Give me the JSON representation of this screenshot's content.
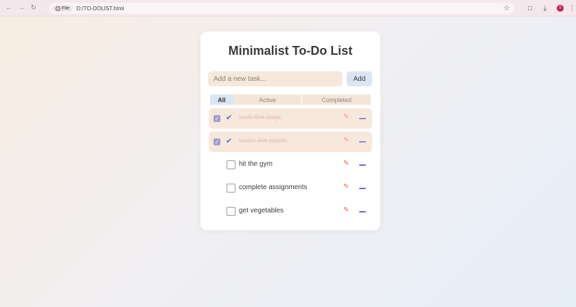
{
  "browser": {
    "back_icon": "arrow-left-icon",
    "forward_icon": "arrow-right-icon",
    "reload_icon": "reload-icon",
    "info_label": "File",
    "url": "D:/TO-DOLIST.html",
    "profile_initial": "S"
  },
  "app": {
    "title": "Minimalist To-Do List",
    "input_placeholder": "Add a new task...",
    "input_value": "",
    "add_label": "Add",
    "filters": {
      "all": "All",
      "active": "Active",
      "completed": "Completed"
    },
    "selected_filter": "All",
    "tasks": [
      {
        "text": "walk the dogs",
        "completed": true
      },
      {
        "text": "water the plants",
        "completed": true
      },
      {
        "text": "hit the gym",
        "completed": false
      },
      {
        "text": "complete assignments",
        "completed": false
      },
      {
        "text": "get vegetables",
        "completed": false
      }
    ],
    "colors": {
      "accent_edit": "#e2684a",
      "accent_delete": "#6b68b8",
      "completed_bg": "#f6e8dc",
      "selected_filter_bg": "#d9e6f4"
    }
  }
}
